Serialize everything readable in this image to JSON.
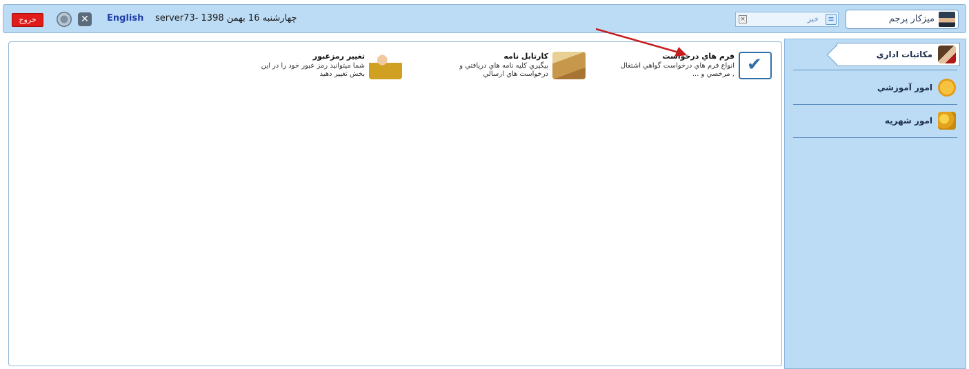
{
  "topbar": {
    "profile_name": "میزکار پرجم",
    "news_label": "خبر",
    "date": "چهارشنبه 16 بهمن 1398 -server73",
    "lang": "English",
    "logout": "خروج"
  },
  "sidebar": {
    "items": [
      {
        "label": "مکاتبات اداري",
        "active": true
      },
      {
        "label": "امور آموزشي",
        "active": false
      },
      {
        "label": "امور شهريه",
        "active": false
      }
    ]
  },
  "cards": [
    {
      "title": "فرم هاي درخواست",
      "desc": "انواع فرم هاي درخواست گواهي اشتغال , مرخصي و ..."
    },
    {
      "title": "کارتابل نامه",
      "desc": "پيگيري کليه نامه هاي دريافتي و درخواست هاي ارسالي"
    },
    {
      "title": "تغيير رمزعبور",
      "desc": "شما ميتوانيد رمز عبور خود را در اين بخش تغيير دهيد"
    }
  ],
  "colors": {
    "topbar_bg": "#bcdcf5",
    "accent": "#1f3fa8",
    "logout_red": "#e11a1a",
    "arrow": "#c41d1d"
  },
  "icons": [
    "user-avatar-icon",
    "news-icon",
    "close-icon",
    "refresh-icon",
    "office-letters-icon",
    "education-icon",
    "tuition-icon",
    "form-checklist-icon",
    "cartable-box-icon",
    "password-lock-icon"
  ]
}
